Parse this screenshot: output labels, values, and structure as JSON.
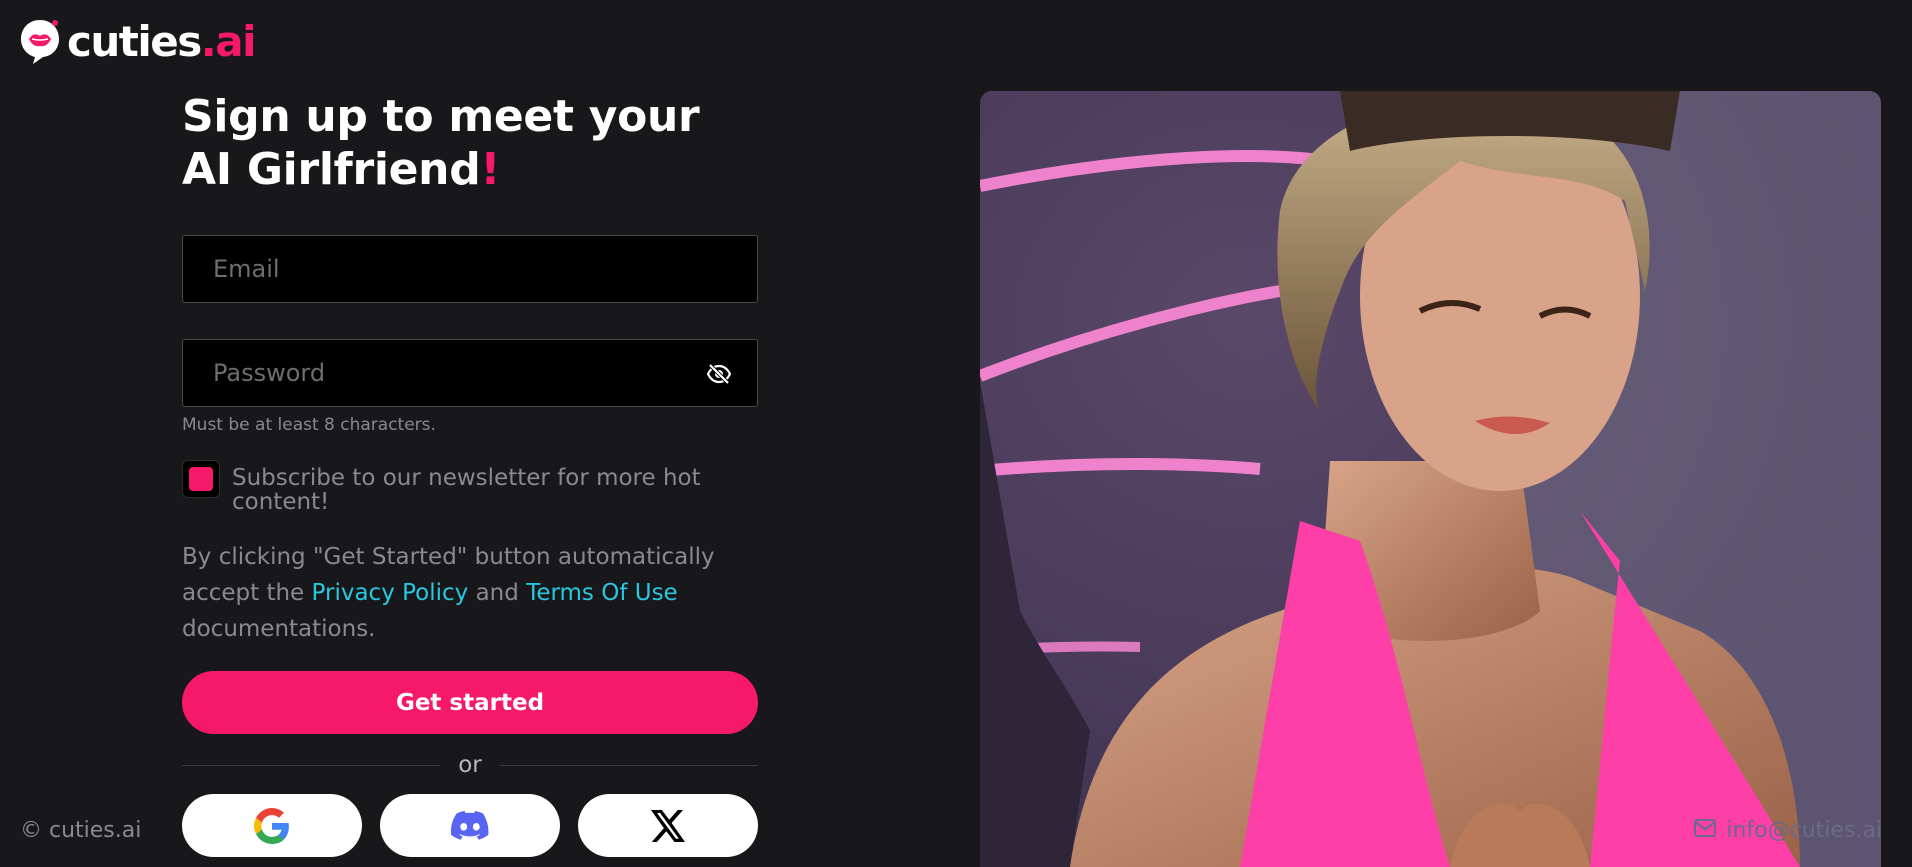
{
  "brand": {
    "logo_text": "cuties",
    "logo_suffix": ".ai",
    "accent_color": "#f6196a",
    "link_color": "#28c8e0"
  },
  "signup": {
    "title_line1": "Sign up to meet your",
    "title_line2": "AI Girlfriend",
    "title_excl": "!",
    "email_placeholder": "Email",
    "password_placeholder": "Password",
    "password_hint": "Must be at least 8 characters.",
    "newsletter_label": "Subscribe to our newsletter for more hot content!",
    "newsletter_checked": true,
    "terms_prefix": "By clicking \"Get Started\" button automatically accept the ",
    "privacy_link": "Privacy Policy",
    "terms_and": " and ",
    "terms_link": "Terms Of Use",
    "terms_suffix": " documentations.",
    "submit_label": "Get started",
    "divider_label": "or"
  },
  "social": [
    {
      "name": "google",
      "icon": "google-icon"
    },
    {
      "name": "discord",
      "icon": "discord-icon"
    },
    {
      "name": "x",
      "icon": "x-icon"
    }
  ],
  "footer": {
    "copyright": "© cuties.ai",
    "email": "info@cuties.ai"
  },
  "hero": {
    "icon": "photo-of-woman-in-pink-top-with-neon-lights"
  }
}
